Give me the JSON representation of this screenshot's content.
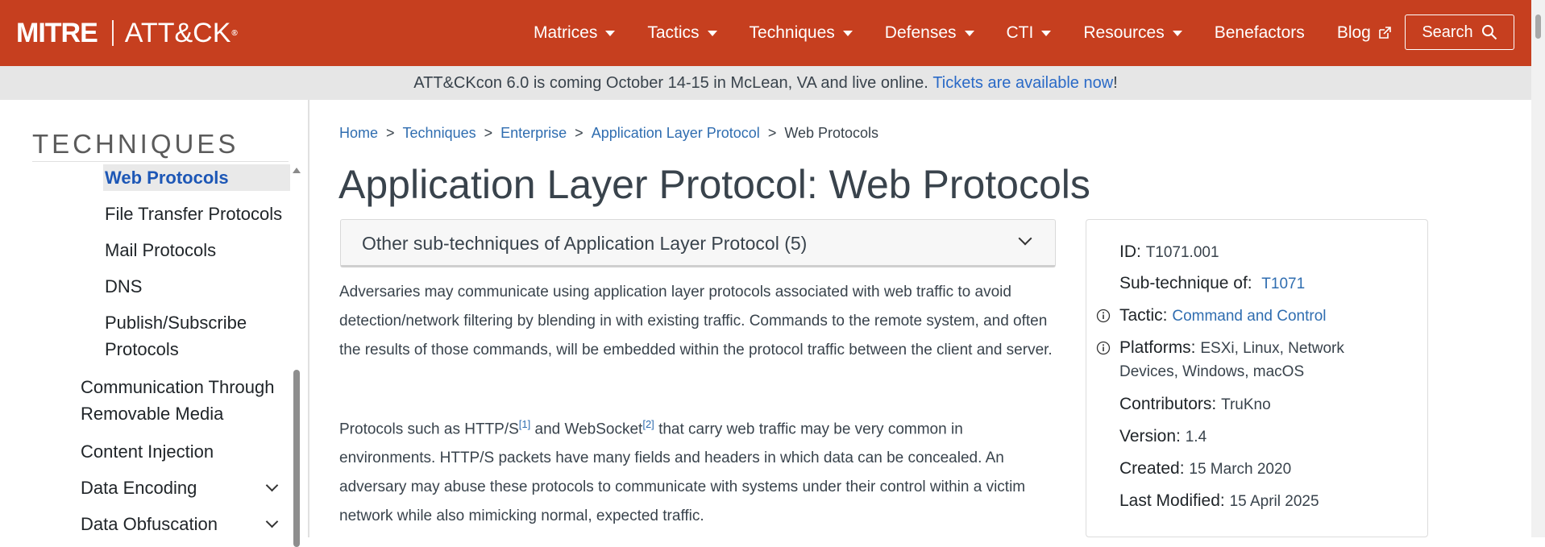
{
  "navbar": {
    "logo_left": "MITRE",
    "logo_right": "ATT&CK",
    "logo_reg": "®",
    "items": [
      {
        "label": "Matrices",
        "dropdown": true
      },
      {
        "label": "Tactics",
        "dropdown": true
      },
      {
        "label": "Techniques",
        "dropdown": true
      },
      {
        "label": "Defenses",
        "dropdown": true
      },
      {
        "label": "CTI",
        "dropdown": true
      },
      {
        "label": "Resources",
        "dropdown": true
      },
      {
        "label": "Benefactors",
        "dropdown": false
      },
      {
        "label": "Blog",
        "dropdown": false,
        "external": true
      }
    ],
    "search_label": "Search",
    "bg_color": "#c63f1f"
  },
  "banner": {
    "text": "ATT&CKcon 6.0 is coming October 14-15 in McLean, VA and live online.",
    "link_text": "Tickets are available now",
    "suffix": "!"
  },
  "sidebar": {
    "title": "TECHNIQUES",
    "items": [
      {
        "label": "Web Protocols",
        "level": 2,
        "active": true
      },
      {
        "label": "File Transfer Protocols",
        "level": 2
      },
      {
        "label": "Mail Protocols",
        "level": 2
      },
      {
        "label": "DNS",
        "level": 2
      },
      {
        "label": "Publish/Subscribe",
        "label2": "Protocols",
        "level": 2
      },
      {
        "label": "Communication Through",
        "label2": "Removable Media",
        "level": 1
      },
      {
        "label": "Content Injection",
        "level": 1
      },
      {
        "label": "Data Encoding",
        "level": 1,
        "expandable": true
      },
      {
        "label": "Data Obfuscation",
        "level": 1,
        "expandable": true
      }
    ]
  },
  "breadcrumb": {
    "items": [
      "Home",
      "Techniques",
      "Enterprise",
      "Application Layer Protocol"
    ],
    "current": "Web Protocols",
    "separator": ">"
  },
  "main": {
    "title": "Application Layer Protocol: Web Protocols",
    "accordion_label": "Other sub-techniques of Application Layer Protocol (5)",
    "para1": "Adversaries may communicate using application layer protocols associated with web traffic to avoid detection/network filtering by blending in with existing traffic. Commands to the remote system, and often the results of those commands, will be embedded within the protocol traffic between the client and server.",
    "para2_a": "Protocols such as HTTP/S",
    "para2_ref1": "[1]",
    "para2_b": " and WebSocket",
    "para2_ref2": "[2]",
    "para2_c": " that carry web traffic may be very common in environments. HTTP/S packets have many fields and headers in which data can be concealed. An adversary may abuse these protocols to communicate with systems under their control within a victim network while also mimicking normal, expected traffic."
  },
  "card": {
    "id_label": "ID:",
    "id_value": "T1071.001",
    "subtech_label": "Sub-technique of:",
    "subtech_value": "T1071",
    "tactic_label": "Tactic:",
    "tactic_value": "Command and Control",
    "platforms_label": "Platforms:",
    "platforms_value1": "ESXi, Linux, Network",
    "platforms_value2": "Devices, Windows, macOS",
    "contributors_label": "Contributors:",
    "contributors_value": "TruKno",
    "version_label": "Version:",
    "version_value": "1.4",
    "created_label": "Created:",
    "created_value": "15 March 2020",
    "modified_label": "Last Modified:",
    "modified_value": "15 April 2025"
  }
}
